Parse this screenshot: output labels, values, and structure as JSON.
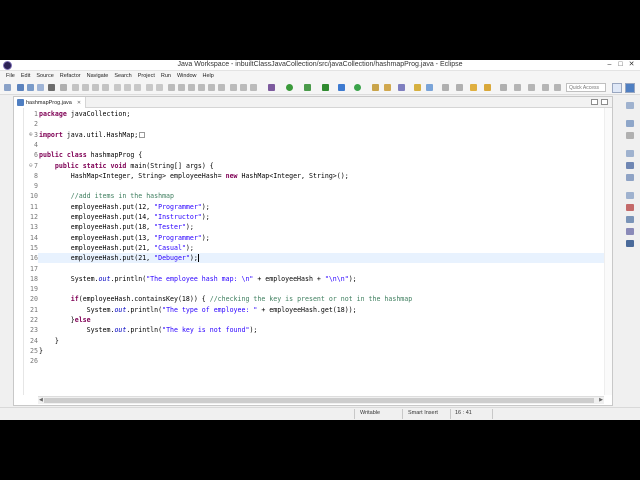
{
  "window": {
    "title": "Java Workspace - inbuiltClassJavaCollection/src/javaCollection/hashmapProg.java - Eclipse"
  },
  "menu": [
    "File",
    "Edit",
    "Source",
    "Refactor",
    "Navigate",
    "Search",
    "Project",
    "Run",
    "Window",
    "Help"
  ],
  "toolbar": {
    "quick_access_placeholder": "Quick Access"
  },
  "editor": {
    "tab_label": "hashmapProg.java",
    "current_line": 16,
    "lines": [
      {
        "n": "1",
        "fold": "",
        "html": "<span class=\"kw\">package</span> javaCollection;"
      },
      {
        "n": "2",
        "fold": "",
        "html": ""
      },
      {
        "n": "3",
        "fold": "⊕",
        "html": "<span class=\"kw\">import</span> java.util.HashMap;<span class=\"fold-box\"></span>"
      },
      {
        "n": "4",
        "fold": "",
        "html": ""
      },
      {
        "n": "6",
        "fold": "",
        "html": "<span class=\"kw\">public</span> <span class=\"kw\">class</span> hashmapProg {"
      },
      {
        "n": "7",
        "fold": "⊖",
        "html": "    <span class=\"kw\">public</span> <span class=\"kw\">static</span> <span class=\"kw\">void</span> main(String[] args) {"
      },
      {
        "n": "8",
        "fold": "",
        "html": "        HashMap&lt;Integer, String&gt; employeeHash= <span class=\"kw\">new</span> HashMap&lt;Integer, String&gt;();"
      },
      {
        "n": "9",
        "fold": "",
        "html": ""
      },
      {
        "n": "10",
        "fold": "",
        "html": "        <span class=\"cmt\">//add items in the hashmap</span>"
      },
      {
        "n": "11",
        "fold": "",
        "html": "        employeeHash.put(12, <span class=\"str\">\"Programmer\"</span>);"
      },
      {
        "n": "12",
        "fold": "",
        "html": "        employeeHash.put(14, <span class=\"str\">\"Instructor\"</span>);"
      },
      {
        "n": "13",
        "fold": "",
        "html": "        employeeHash.put(18, <span class=\"str\">\"Tester\"</span>);"
      },
      {
        "n": "14",
        "fold": "",
        "html": "        employeeHash.put(13, <span class=\"str\">\"Programmer\"</span>);"
      },
      {
        "n": "15",
        "fold": "",
        "html": "        employeeHash.put(21, <span class=\"str\">\"Casual\"</span>);"
      },
      {
        "n": "16",
        "fold": "",
        "html": "        employeeHash.put(21, <span class=\"str\">\"Debuger\"</span>);<span class=\"cursor\"></span>"
      },
      {
        "n": "17",
        "fold": "",
        "html": ""
      },
      {
        "n": "18",
        "fold": "",
        "html": "        System.<span class=\"fld\">out</span>.println(<span class=\"str\">\"The employee hash map: \\n\"</span> + employeeHash + <span class=\"str\">\"\\n\\n\"</span>);"
      },
      {
        "n": "19",
        "fold": "",
        "html": ""
      },
      {
        "n": "20",
        "fold": "",
        "html": "        <span class=\"kw\">if</span>(employeeHash.containsKey(18)) { <span class=\"cmt\">//checking the key is present or not in the hashmap</span>"
      },
      {
        "n": "21",
        "fold": "",
        "html": "            System.<span class=\"fld\">out</span>.println(<span class=\"str\">\"The type of employee: \"</span> + employeeHash.get(18));"
      },
      {
        "n": "22",
        "fold": "",
        "html": "        }<span class=\"kw\">else</span>"
      },
      {
        "n": "23",
        "fold": "",
        "html": "            System.<span class=\"fld\">out</span>.println(<span class=\"str\">\"The key is not found\"</span>);"
      },
      {
        "n": "24",
        "fold": "",
        "html": "    }"
      },
      {
        "n": "25",
        "fold": "",
        "html": "}"
      },
      {
        "n": "26",
        "fold": "",
        "html": ""
      }
    ]
  },
  "status": {
    "writable": "Writable",
    "insert_mode": "Smart Insert",
    "position": "16 : 41"
  },
  "colors": {
    "keyword": "#7f0055",
    "string": "#2a00ff",
    "comment": "#3f7f5f",
    "static_field": "#0000c0",
    "current_line": "#e8f2fe"
  }
}
